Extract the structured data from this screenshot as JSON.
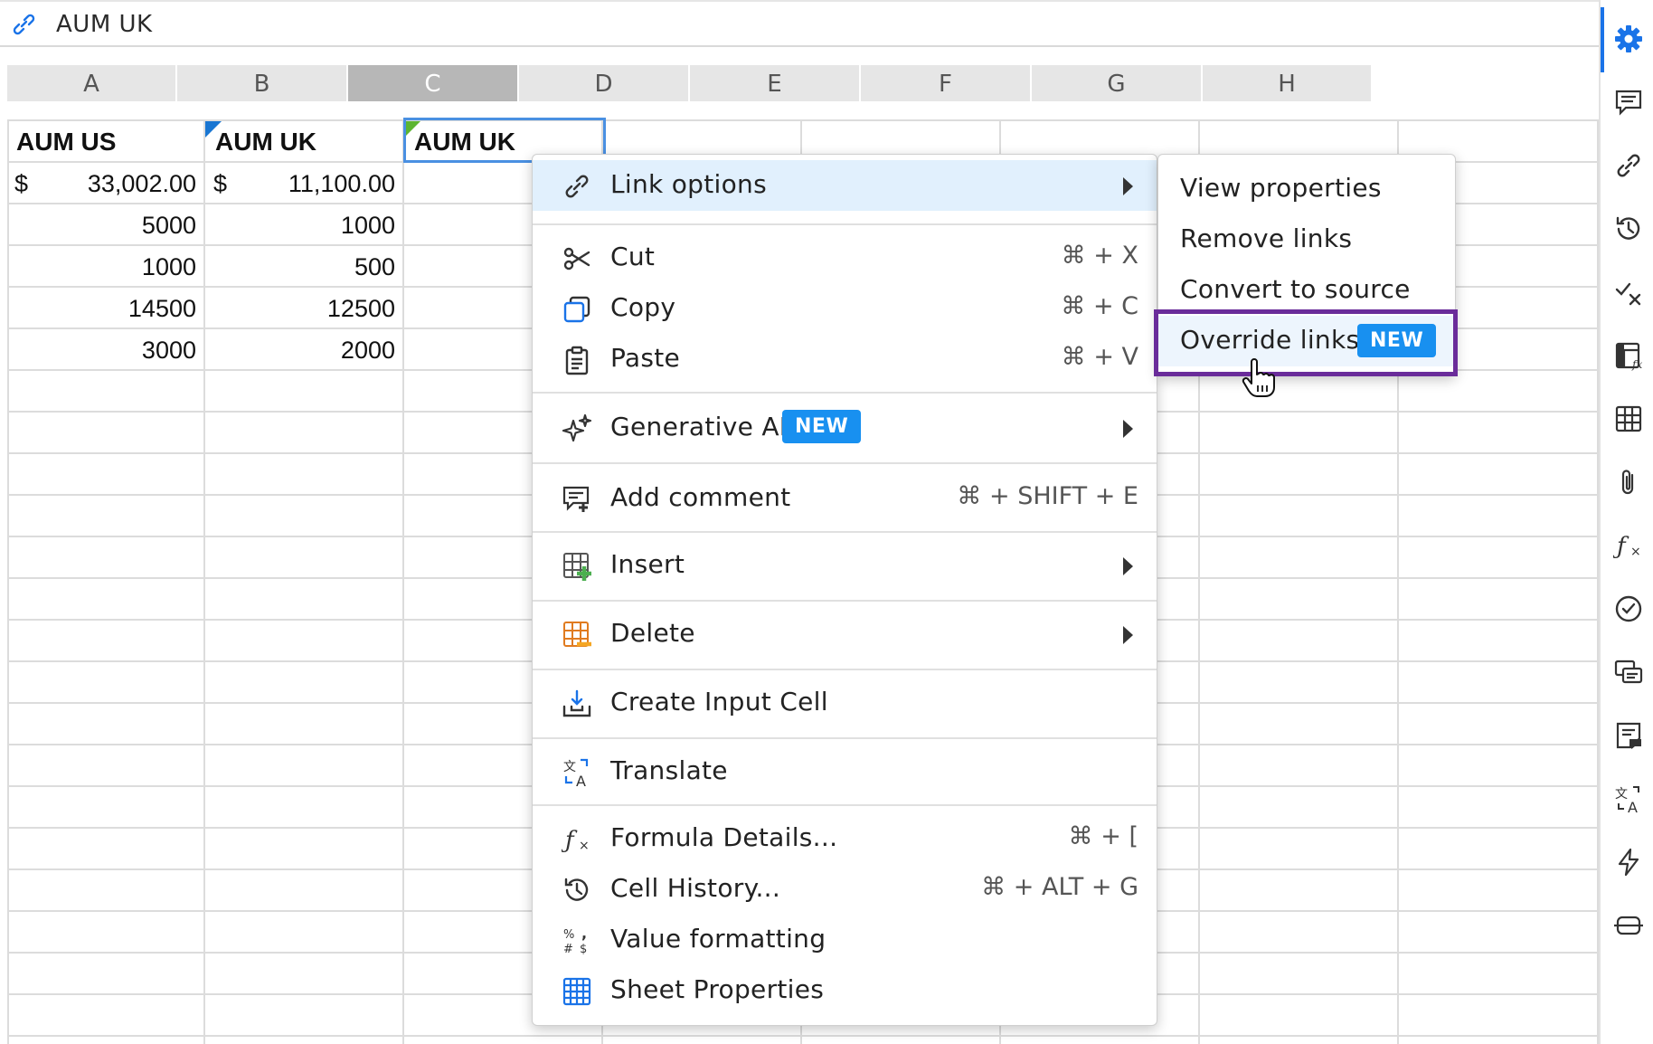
{
  "formula_bar": {
    "icon": "link-icon",
    "value": "AUM UK"
  },
  "columns": [
    "A",
    "B",
    "C",
    "D",
    "E",
    "F",
    "G",
    "H"
  ],
  "selected_column": "C",
  "cells": {
    "A1": "AUM US",
    "B1": "AUM UK",
    "C1": "AUM UK",
    "A2_currency": "$",
    "A2": "33,002.00",
    "B2_currency": "$",
    "B2": "11,100.00",
    "A3": "5000",
    "B3": "1000",
    "A4": "1000",
    "B4": "500",
    "A5": "14500",
    "B5": "12500",
    "A6": "3000",
    "B6": "2000"
  },
  "context_menu": {
    "link_options": {
      "label": "Link options",
      "icon": "link-icon"
    },
    "cut": {
      "label": "Cut",
      "shortcut": "⌘ + X",
      "icon": "scissors-icon"
    },
    "copy": {
      "label": "Copy",
      "shortcut": "⌘ + C",
      "icon": "copy-icon"
    },
    "paste": {
      "label": "Paste",
      "shortcut": "⌘ + V",
      "icon": "clipboard-icon"
    },
    "generative_ai": {
      "label": "Generative AI",
      "badge": "NEW",
      "icon": "sparkle-icon"
    },
    "add_comment": {
      "label": "Add comment",
      "shortcut": "⌘ + SHIFT + E",
      "icon": "comment-add-icon"
    },
    "insert": {
      "label": "Insert",
      "icon": "grid-plus-icon"
    },
    "delete": {
      "label": "Delete",
      "icon": "grid-minus-icon"
    },
    "create_input_cell": {
      "label": "Create Input Cell",
      "icon": "download-tray-icon"
    },
    "translate": {
      "label": "Translate",
      "icon": "translate-icon"
    },
    "formula_details": {
      "label": "Formula Details...",
      "shortcut": "⌘ + [",
      "icon": "fx-icon"
    },
    "cell_history": {
      "label": "Cell History...",
      "shortcut": "⌘ + ALT + G",
      "icon": "history-icon"
    },
    "value_formatting": {
      "label": "Value formatting",
      "icon": "number-format-icon"
    },
    "sheet_properties": {
      "label": "Sheet Properties",
      "icon": "table-icon"
    }
  },
  "submenu": {
    "view_properties": "View properties",
    "remove_links": "Remove links",
    "convert_to_source": "Convert to source",
    "override_links": "Override links",
    "override_badge": "NEW"
  },
  "sidebar": [
    "gear-icon",
    "comment-icon",
    "link-icon",
    "history-icon",
    "check-x-icon",
    "formula-sheet-icon",
    "table-icon",
    "paperclip-icon",
    "fx-icon",
    "check-circle-icon",
    "conversations-icon",
    "notes-icon",
    "translate-icon",
    "lightning-icon",
    "dependency-icon"
  ],
  "colors": {
    "accent": "#1a73e8",
    "badge": "#1890f0",
    "focus": "#6a2c9a",
    "highlight": "#e1f0fd"
  }
}
